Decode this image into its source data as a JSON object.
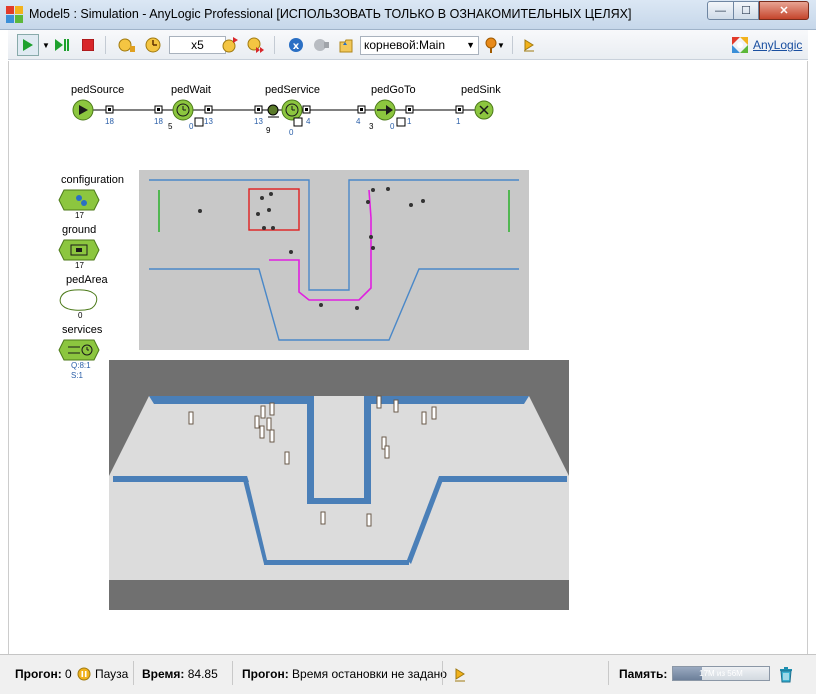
{
  "window": {
    "title": "Model5 : Simulation - AnyLogic Professional [ИСПОЛЬЗОВАТЬ ТОЛЬКО В ОЗНАКОМИТЕЛЬНЫХ ЦЕЛЯХ]",
    "minimize": "—",
    "maximize": "☐",
    "close": "✕"
  },
  "toolbar": {
    "speed": "x5",
    "context_selector": "корневой:Main",
    "brand": "AnyLogic",
    "icons": [
      "run-icon",
      "pause-step-icon",
      "stop-icon",
      "slow-down-icon",
      "step-icon",
      "speed-up-icon",
      "fast-forward-icon",
      "navigate-icon",
      "camera-icon",
      "home-icon",
      "pin-icon",
      "expand-icon"
    ]
  },
  "flowchart": {
    "blocks": [
      {
        "name": "pedSource",
        "in": "",
        "out": "18"
      },
      {
        "name": "pedWait",
        "in": "18",
        "count": "5",
        "ghost": "0",
        "out": "13"
      },
      {
        "name": "pedService",
        "in": "13",
        "count": "9",
        "ghost": "0",
        "out": "4"
      },
      {
        "name": "pedGoTo",
        "in": "4",
        "count": "3",
        "ghost": "0",
        "out": "1"
      },
      {
        "name": "pedSink",
        "in": "1"
      }
    ]
  },
  "sidebar": {
    "configuration": {
      "label": "configuration",
      "count": "17"
    },
    "ground": {
      "label": "ground",
      "count": "17"
    },
    "pedArea": {
      "label": "pedArea",
      "count": "0"
    },
    "services": {
      "label": "services",
      "queue": "Q:8:1",
      "service": "S:1"
    }
  },
  "status": {
    "run_label": "Прогон:",
    "run_value": "0",
    "state": "Пауза",
    "time_label": "Время:",
    "time_value": "84.85",
    "run2_label": "Прогон:",
    "stop_time": "Время остановки не задано",
    "memory_label": "Память:",
    "memory_text": "17M из 56M",
    "memory_fraction": 0.3
  },
  "colors": {
    "block_green": "#8cc63f",
    "wall_blue": "#3f7cc4",
    "path_magenta": "#e020e0",
    "selection_red": "#e02020"
  }
}
